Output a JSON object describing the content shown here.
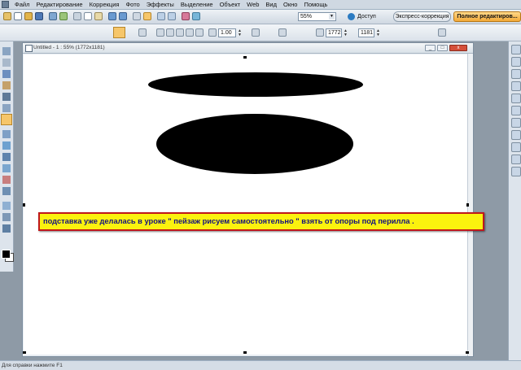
{
  "menu": [
    "Файл",
    "Редактирование",
    "Коррекция",
    "Фото",
    "Эффекты",
    "Выделение",
    "Объект",
    "Web",
    "Вид",
    "Окно",
    "Помощь"
  ],
  "toolbar": {
    "zoom_value": "55%",
    "access_label": "Доступ",
    "express_tab": "Экспресс-коррекция",
    "full_tab": "Полное редактиров..."
  },
  "options": {
    "scale": "1.00",
    "width": "1772",
    "height": "1181"
  },
  "document": {
    "title": "Untitled - 1 : 55% (1772x1181)"
  },
  "annotation": {
    "text": "подставка уже делалась в уроке \" пейзаж рисуем самостоятельно \" взять от опоры под перилла ."
  },
  "status": {
    "text": "Для справки нажмите F1"
  },
  "colors": {
    "accent": "#f6c66a",
    "annotation_bg": "#fbf20e",
    "annotation_border": "#c0181b",
    "annotation_text": "#14127e"
  }
}
